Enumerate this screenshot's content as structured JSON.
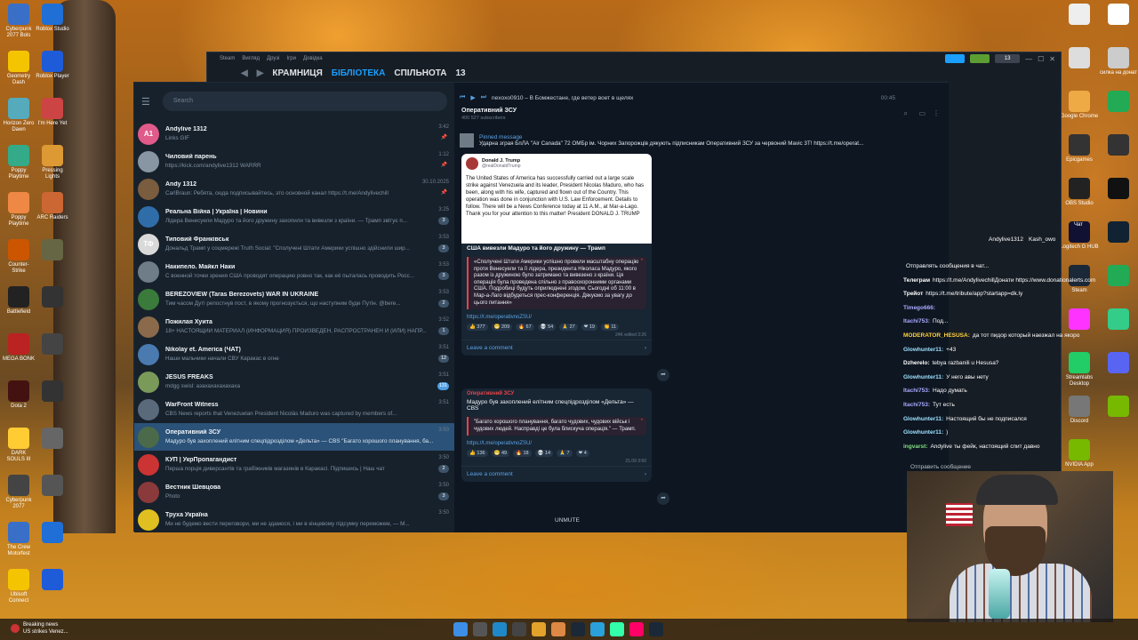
{
  "desktop": {
    "left_icons": [
      "Cyberpunk 2077 Bols",
      "Roblox Studio",
      "Geometry Dash",
      "Roblox Player",
      "Horizon Zero Dawn",
      "I'm Here Yet",
      "Poppy Playtime",
      "Pressing Lights",
      "Poppy Playtime",
      "ARC Raiders",
      "Counter-Strike",
      "",
      "Battlefield",
      "",
      "MEGA BONK",
      "",
      "Dota 2",
      "",
      "DARK SOULS III",
      "",
      "Cyberpunk 2077",
      "",
      "The Crew Motorfest",
      "",
      "Ubisoft Connect",
      ""
    ],
    "right_icons": [
      "",
      "",
      "",
      "силка на донат",
      "Google Chrome",
      "",
      "Epicgames",
      "",
      "OBS Studio",
      "",
      "Logitech G HUB",
      "",
      "Steam",
      "",
      "",
      "",
      "Streamlabs Desktop",
      "",
      "Discord",
      "",
      "NVIDIA App"
    ],
    "chat_label": "Чат"
  },
  "steam": {
    "menu": [
      "Steam",
      "Вигляд",
      "Друзі",
      "Ігри",
      "Довідка"
    ],
    "nav": {
      "store": "КРАМНИЦЯ",
      "library": "БІБЛІОТЕКА",
      "community": "СПІЛЬНОТА",
      "count": "13"
    },
    "controls": {
      "count": "13"
    }
  },
  "telegram": {
    "search_placeholder": "Search",
    "chats": [
      {
        "name": "Andylive 1312",
        "preview": "Links GIF",
        "time": "3:42",
        "avatar_text": "A1",
        "avatar_color": "#e05a8a",
        "badge": "",
        "pinned": true
      },
      {
        "name": "Чиловий парень",
        "preview": "https://kick.com/andylive1312 WARRR",
        "time": "1:12",
        "avatar_text": "",
        "avatar_color": "#8896a3",
        "badge": "",
        "pinned": true
      },
      {
        "name": "Andy 1312",
        "preview": "CarlBraun: Ребята, сюда подписывайтесь, это основной канал https://t.me/Andylivechill",
        "time": "30.10.2025",
        "avatar_text": "",
        "avatar_color": "#7a5c3f",
        "badge": "",
        "pinned": true
      },
      {
        "name": "Реальна Війна | Україна | Новини",
        "preview": "Лідера Венесуели Мадуро та його дружину захопили та вивезли з країни. — Трамп звітує п...",
        "time": "3:25",
        "avatar_text": "",
        "avatar_color": "#2f6da8",
        "badge": "3",
        "pinned": false
      },
      {
        "name": "Типовий Франківськ",
        "preview": "Дональд Трамп у соцмережі Truth Social: \"Сполучені Штати Америки успішно здійснили шир...",
        "time": "3:53",
        "avatar_text": "ТФ",
        "avatar_color": "#d9d9d9",
        "badge": "3",
        "pinned": false
      },
      {
        "name": "Накипело. Майкл Наки",
        "preview": "С военной точки зрения США проводят операцию ровно так, как её пыталась проводить Росс...",
        "time": "3:53",
        "avatar_text": "",
        "avatar_color": "#6e7d88",
        "badge": "3",
        "pinned": false
      },
      {
        "name": "BEREZOVIEW (Taras Berezovets) WAR IN UKRAINE",
        "preview": "Тим часом Дуті репостнув пост, в якому прогнозується, що наступним буде Путін.  @bere...",
        "time": "3:53",
        "avatar_text": "",
        "avatar_color": "#3a7a3a",
        "badge": "2",
        "pinned": false
      },
      {
        "name": "Пожилая Хуита",
        "preview": "18+ НАСТОЯЩИЙ МАТЕРИАЛ (ИНФОРМАЦИЯ) ПРОИЗВЕДЕН, РАСПРОСТРАНЕН И (ИЛИ) НАПР...",
        "time": "3:52",
        "avatar_text": "",
        "avatar_color": "#8a6a4a",
        "badge": "1",
        "pinned": false
      },
      {
        "name": "Nikolay et. America (ЧАТ)",
        "preview": "Наши мальчики начали СВУ Каракас в огне",
        "time": "3:51",
        "avatar_text": "",
        "avatar_color": "#4a7ab0",
        "badge": "12",
        "pinned": false
      },
      {
        "name": "JESUS FREAKS",
        "preview": "mdgg swisl: азахахахахахаха",
        "time": "3:51",
        "avatar_text": "",
        "avatar_color": "#7a9a5a",
        "badge": "131",
        "pinned": false
      },
      {
        "name": "WarFront Witness",
        "preview": "CBS News reports that Venezuelan President Nicolás Maduro was captured by members of...",
        "time": "3:51",
        "avatar_text": "",
        "avatar_color": "#5a6a7a",
        "badge": "",
        "pinned": false
      },
      {
        "name": "Оперативний ЗСУ",
        "preview": "Мадуро був захоплений елітним спецпідрозділом «Дельта» — CBS  \"Багато хорошого планування, ба...",
        "time": "3:50",
        "avatar_text": "",
        "avatar_color": "#4a6a4a",
        "badge": "",
        "pinned": false,
        "selected": true
      },
      {
        "name": "КУП | УкрПропагандист",
        "preview": "Перша порція диверсантів та грабіжників магазинів в Каракасі.  Підпишись | Наш чат",
        "time": "3:50",
        "avatar_text": "",
        "avatar_color": "#c33",
        "badge": "2",
        "pinned": false
      },
      {
        "name": "Вестник Шевцова",
        "preview": "Photo",
        "time": "3:50",
        "avatar_text": "",
        "avatar_color": "#8a3a3a",
        "badge": "3",
        "pinned": false
      },
      {
        "name": "Труха Україна",
        "preview": "Ми не будемо вести переговори, ми не здамося, і ми в кінцевому підсумку переможем, — М...",
        "time": "3:50",
        "avatar_text": "",
        "avatar_color": "#e0c020",
        "badge": "",
        "pinned": false
      }
    ],
    "media_player": {
      "title": "nexoxo0910 – В Бомжестане, где ветер воет в щелях",
      "time": "00:45"
    },
    "channel": {
      "title": "Оперативний ЗСУ",
      "subscribers": "400 527 subscribers"
    },
    "pinned": {
      "label": "Pinned message",
      "text": "Ударна зграя БпЛА \"Air Canada\" 72 ОМБр ім. Чорних Запорожців дякують підписникам Оперативний ЗСУ за червоний Mavic 3T! https://t.me/operat..."
    },
    "post1": {
      "tweet_name": "Donald J. Trump",
      "tweet_handle": "@realDonaldTrump",
      "tweet_text": "The United States of America has successfully carried out a large scale strike against Venezuela and its leader, President Nicolas Maduro, who has been, along with his wife, captured and flown out of the Country. This operation was done in conjunction with U.S. Law Enforcement. Details to follow. There will be a News Conference today at 11 A.M., at Mar-a-Lago. Thank you for your attention to this matter! President DONALD J. TRUMP",
      "title": "США вивезли Мадуро та його дружину — Трамп",
      "quote": "«Сполучені Штати Америки успішно провели масштабну операцію проти Венесуели та її лідера, президента Ніколаса Мадуро, якого разом із дружиною було затримано та вивезено з країни. Ця операція була проведена спільно з правоохоронними органами США. Подробиці будуть оприлюднені згодом. Сьогодні об 11:00 в Мар-а-Лаго відбудеться прес-конференція. Дякуємо за увагу до цього питання»",
      "link": "https://t.me/operativnoZSU/",
      "reactions": [
        "377",
        "209",
        "67",
        "54",
        "27",
        "19",
        "11"
      ],
      "meta": "24K  edited 3:26",
      "comment": "Leave a comment"
    },
    "post2": {
      "author": "Оперативний ЗСУ",
      "title": "Мадуро був захоплений елітним спецпідрозділом «Дельта» — CBS",
      "quote": "\"Багато хорошого планування, багато чудових, чудових військ і чудових людей. Насправді це була блискуча операція.\" — Трамп.",
      "link": "https://t.me/operativnoZSU/",
      "reactions": [
        "136",
        "49",
        "18",
        "14",
        "7",
        "4"
      ],
      "meta": "21.09  3:50",
      "comment": "Leave a comment"
    },
    "unmute": "UNMUTE"
  },
  "stream_chat": {
    "nametag": {
      "user": "Andylive1312",
      "other": "Kash_owo"
    },
    "lines": [
      {
        "user": "",
        "text": "Отправлять сообщения в чат...",
        "color": "#ffffff"
      },
      {
        "user": "Телеграм",
        "text": "https://t.me/AndylivechillДонати https://www.donationalerts.com",
        "color": "#ffffff"
      },
      {
        "user": "Трейот",
        "text": "https://t.me/tribute/app?startapp=dk.ly",
        "color": "#ffffff"
      },
      {
        "user": "Timego666:",
        "text": "",
        "color": "#a9a9ff"
      },
      {
        "user": "Itachi753:",
        "text": "Под...",
        "color": "#a9a9ff"
      },
      {
        "user": "MODERATOR_HESUSA:",
        "text": "да тот пидор который наезжал на якоро",
        "color": "#ffd23a"
      },
      {
        "user": "Glowhunter11:",
        "text": "+43",
        "color": "#9be0ff"
      },
      {
        "user": "Dzherelo:",
        "text": "tebya razbanili u Hesusa?",
        "color": "#ffffff"
      },
      {
        "user": "Glowhunter11:",
        "text": "У него авы нету",
        "color": "#9be0ff"
      },
      {
        "user": "Itachi753:",
        "text": "Надо думать",
        "color": "#a9a9ff"
      },
      {
        "user": "Itachi753:",
        "text": "Тут есть",
        "color": "#a9a9ff"
      },
      {
        "user": "Glowhunter11:",
        "text": "Настоящий бы не подписался",
        "color": "#9be0ff"
      },
      {
        "user": "Glowhunter11:",
        "text": ")",
        "color": "#9be0ff"
      },
      {
        "user": "ingvarst:",
        "text": "Andylive ты фейк, настоящий спит давно",
        "color": "#7fe07f"
      }
    ],
    "send_placeholder": "Отправить сообщение"
  },
  "taskbar": {
    "news_title": "Breaking news",
    "news_sub": "US strikes Venez..."
  },
  "colors": {
    "accent": "#1a9fff",
    "tg_blue": "#5ba4e6",
    "selected": "#2b5278"
  }
}
